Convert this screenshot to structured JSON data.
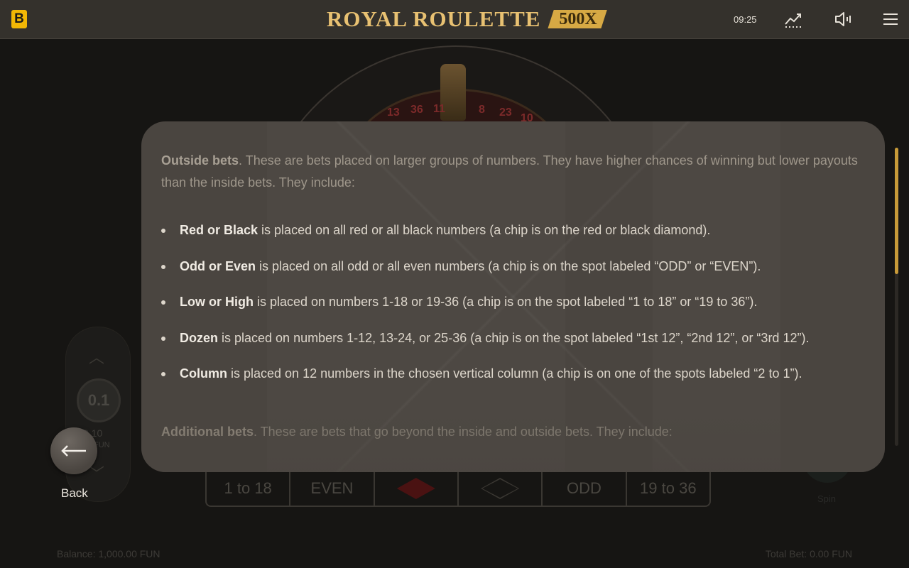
{
  "header": {
    "logo_letter": "B",
    "title": "ROYAL ROULETTE",
    "title_badge": "500X",
    "clock": "09:25",
    "icons": [
      "history-chart-icon",
      "sound-icon",
      "menu-icon"
    ]
  },
  "background": {
    "wheel_numbers": [
      "13",
      "36",
      "11",
      "8",
      "23",
      "10"
    ],
    "stake_chip": "0.1",
    "stake_value": "0.10",
    "stake_unit": "FUN",
    "board_cells": [
      "1 to 18",
      "EVEN",
      "",
      "",
      "ODD",
      "19 to 36"
    ],
    "spin_label": "Spin",
    "balance": "Balance: 1,000.00 FUN",
    "total_bet": "Total Bet: 0.00 FUN"
  },
  "help": {
    "intro_bold": "Outside bets",
    "intro_text": ". These are bets placed on larger groups of numbers. They have higher chances of winning but lower payouts than the inside bets. They include:",
    "items": [
      {
        "term": "Red or Black",
        "text": " is placed on all red or all black numbers (a chip is on the red or black diamond)."
      },
      {
        "term": "Odd or Even",
        "text": " is placed on all odd or all even numbers (a chip is on the spot labeled “ODD” or “EVEN”)."
      },
      {
        "term": "Low or High",
        "text": " is placed on numbers 1-18 or 19-36 (a chip is on the spot labeled “1 to 18” or “19 to 36”)."
      },
      {
        "term": "Dozen",
        "text": " is placed on numbers 1-12, 13-24, or 25-36 (a chip is on the spot labeled “1st 12”, “2nd 12”, or “3rd 12”)."
      },
      {
        "term": "Column",
        "text": " is placed on 12 numbers in the chosen vertical column (a chip is on one of the spots labeled “2 to 1”)."
      }
    ],
    "additional_bold": "Additional bets",
    "additional_text": ". These are bets that go beyond the inside and outside bets. They include:"
  },
  "back": {
    "label": "Back"
  },
  "colors": {
    "accent": "#c79a38",
    "brand": "#f2b705",
    "panel": "#4a4540"
  }
}
